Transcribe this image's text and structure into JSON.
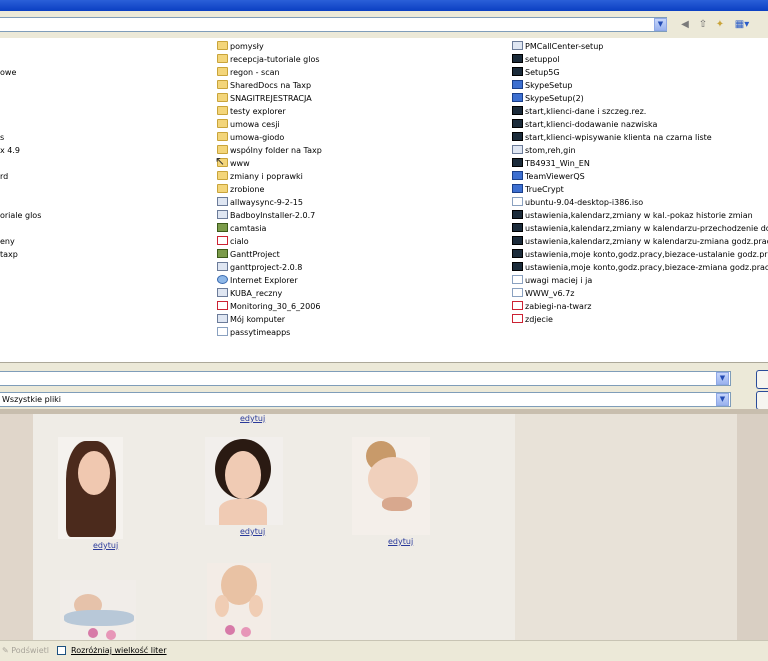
{
  "toolbar": {
    "path_value": "",
    "icons": [
      "back-icon",
      "up-folder-icon",
      "new-folder-icon",
      "view-menu-icon"
    ]
  },
  "files": {
    "col1": [
      "owe",
      "s",
      "x 4.9",
      "rd",
      "oriale glos",
      "eny",
      "taxp"
    ],
    "col2": [
      {
        "name": "pomysły",
        "icon": "folder"
      },
      {
        "name": "recepcja-tutoriale glos",
        "icon": "folder"
      },
      {
        "name": "regon - scan",
        "icon": "folder"
      },
      {
        "name": "SharedDocs na Taxp",
        "icon": "folder"
      },
      {
        "name": "SNAGITREJESTRACJA",
        "icon": "folder"
      },
      {
        "name": "testy explorer",
        "icon": "folder"
      },
      {
        "name": "umowa cesji",
        "icon": "folder"
      },
      {
        "name": "umowa-giodo",
        "icon": "folder"
      },
      {
        "name": "wspólny folder na Taxp",
        "icon": "folder"
      },
      {
        "name": "www",
        "icon": "folder"
      },
      {
        "name": "zmiany i poprawki",
        "icon": "folder"
      },
      {
        "name": "zrobione",
        "icon": "folder"
      },
      {
        "name": "allwaysync-9-2-15",
        "icon": "app"
      },
      {
        "name": "BadboyInstaller-2.0.7",
        "icon": "app"
      },
      {
        "name": "camtasia",
        "icon": "cam"
      },
      {
        "name": "cialo",
        "icon": "pdf"
      },
      {
        "name": "GanttProject",
        "icon": "cam"
      },
      {
        "name": "ganttproject-2.0.8",
        "icon": "app"
      },
      {
        "name": "Internet Explorer",
        "icon": "globe"
      },
      {
        "name": "KUBA_reczny",
        "icon": "app"
      },
      {
        "name": "Monitoring_30_6_2006",
        "icon": "pdf"
      },
      {
        "name": "Mój komputer",
        "icon": "app"
      },
      {
        "name": "passytimeapps",
        "icon": "doc"
      }
    ],
    "col3": [
      {
        "name": "PMCallCenter-setup",
        "icon": "app"
      },
      {
        "name": "setuppol",
        "icon": "term"
      },
      {
        "name": "Setup5G",
        "icon": "term"
      },
      {
        "name": "SkypeSetup",
        "icon": "blue"
      },
      {
        "name": "SkypeSetup(2)",
        "icon": "blue"
      },
      {
        "name": "start,klienci-dane i szczeg.rez.",
        "icon": "term"
      },
      {
        "name": "start,klienci-dodawanie nazwiska",
        "icon": "term"
      },
      {
        "name": "start,klienci-wpisywanie klienta na czarna liste",
        "icon": "term"
      },
      {
        "name": "stom,reh,gin",
        "icon": "app"
      },
      {
        "name": "TB4931_Win_EN",
        "icon": "term"
      },
      {
        "name": "TeamViewerQS",
        "icon": "blue"
      },
      {
        "name": "TrueCrypt",
        "icon": "blue"
      },
      {
        "name": "ubuntu-9.04-desktop-i386.iso",
        "icon": "doc"
      },
      {
        "name": "ustawienia,kalendarz,zmiany w kal.-pokaz historie zmian",
        "icon": "term"
      },
      {
        "name": "ustawienia,kalendarz,zmiany w kalendarzu-przechodzenie do dni",
        "icon": "term"
      },
      {
        "name": "ustawienia,kalendarz,zmiany w kalendarzu-zmiana godz.pracy na",
        "icon": "term"
      },
      {
        "name": "ustawienia,moje konto,godz.pracy,biezace-ustalanie godz.pracy",
        "icon": "term"
      },
      {
        "name": "ustawienia,moje konto,godz.pracy,biezace-zmiana godz.pracy",
        "icon": "term"
      },
      {
        "name": "uwagi maciej i ja",
        "icon": "doc"
      },
      {
        "name": "WWW_v6.7z",
        "icon": "doc"
      },
      {
        "name": "zabiegi-na-twarz",
        "icon": "pdf"
      },
      {
        "name": "zdjecie",
        "icon": "pdf"
      }
    ]
  },
  "filename_field": {
    "value": ""
  },
  "filetype_field": {
    "value": "Wszystkie pliki"
  },
  "web": {
    "top_link": "edytuj",
    "links": [
      "edytuj",
      "edytuj",
      "edytuj"
    ]
  },
  "statusbar": {
    "highlight_label": "Podświetl",
    "case_label": "Rozróżniaj wielkość liter"
  }
}
